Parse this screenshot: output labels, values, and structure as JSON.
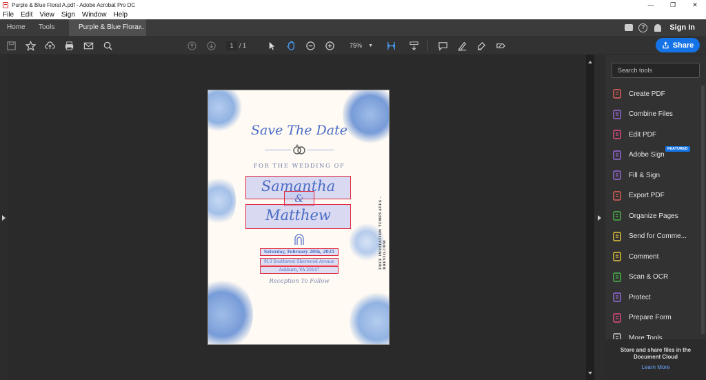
{
  "window": {
    "title": "Purple & Blue Floral A.pdf - Adobe Acrobat Pro DC",
    "controls": [
      "—",
      "❐",
      "✕"
    ]
  },
  "menu": [
    "File",
    "Edit",
    "View",
    "Sign",
    "Window",
    "Help"
  ],
  "tabs": {
    "home": "Home",
    "tools": "Tools",
    "active": "Purple & Blue Flora...",
    "close": "×"
  },
  "header": {
    "sign_in": "Sign In",
    "help_glyph": "?"
  },
  "toolbar": {
    "page_current": "1",
    "page_total": "/ 1",
    "zoom": "75%",
    "share": "Share"
  },
  "document": {
    "title": "Save The Date",
    "subtitle": "FOR THE WEDDING OF",
    "name1": "Samantha",
    "amp": "&",
    "name2": "Matthew",
    "date": "Saturday, February 20th, 2025",
    "address1": "913 Southwest Sherwood Avenue",
    "address2": "Ashburn, VA 20147",
    "reception": "Reception To Follow",
    "side_text": "FREE INVITATION TEMPLATES - DREVIO.COM"
  },
  "tools": {
    "search_placeholder": "Search tools",
    "items": [
      {
        "label": "Create PDF",
        "icon": "create-pdf-icon",
        "color": "#e8615a"
      },
      {
        "label": "Combine Files",
        "icon": "combine-files-icon",
        "color": "#9b6bde"
      },
      {
        "label": "Edit PDF",
        "icon": "edit-pdf-icon",
        "color": "#e84c8a"
      },
      {
        "label": "Adobe Sign",
        "icon": "adobe-sign-icon",
        "color": "#9b6bde"
      },
      {
        "label": "Fill & Sign",
        "icon": "fill-sign-icon",
        "color": "#9b6bde"
      },
      {
        "label": "Export PDF",
        "icon": "export-pdf-icon",
        "color": "#e8615a"
      },
      {
        "label": "Organize Pages",
        "icon": "organize-pages-icon",
        "color": "#49b84a"
      },
      {
        "label": "Send for Comme...",
        "icon": "send-comment-icon",
        "color": "#e8c53a"
      },
      {
        "label": "Comment",
        "icon": "comment-icon",
        "color": "#e8c53a"
      },
      {
        "label": "Scan & OCR",
        "icon": "scan-ocr-icon",
        "color": "#49b84a"
      },
      {
        "label": "Protect",
        "icon": "protect-icon",
        "color": "#9b6bde"
      },
      {
        "label": "Prepare Form",
        "icon": "prepare-form-icon",
        "color": "#e84c8a"
      },
      {
        "label": "More Tools",
        "icon": "more-tools-icon",
        "color": "#cccccc"
      }
    ],
    "featured_badge": "FEATURED"
  },
  "cloud": {
    "text": "Store and share files in the Document Cloud",
    "link": "Learn More"
  },
  "colors": {
    "accent": "#1473e6",
    "script": "#4a6cc5",
    "highlight_border": "#e0283f"
  }
}
